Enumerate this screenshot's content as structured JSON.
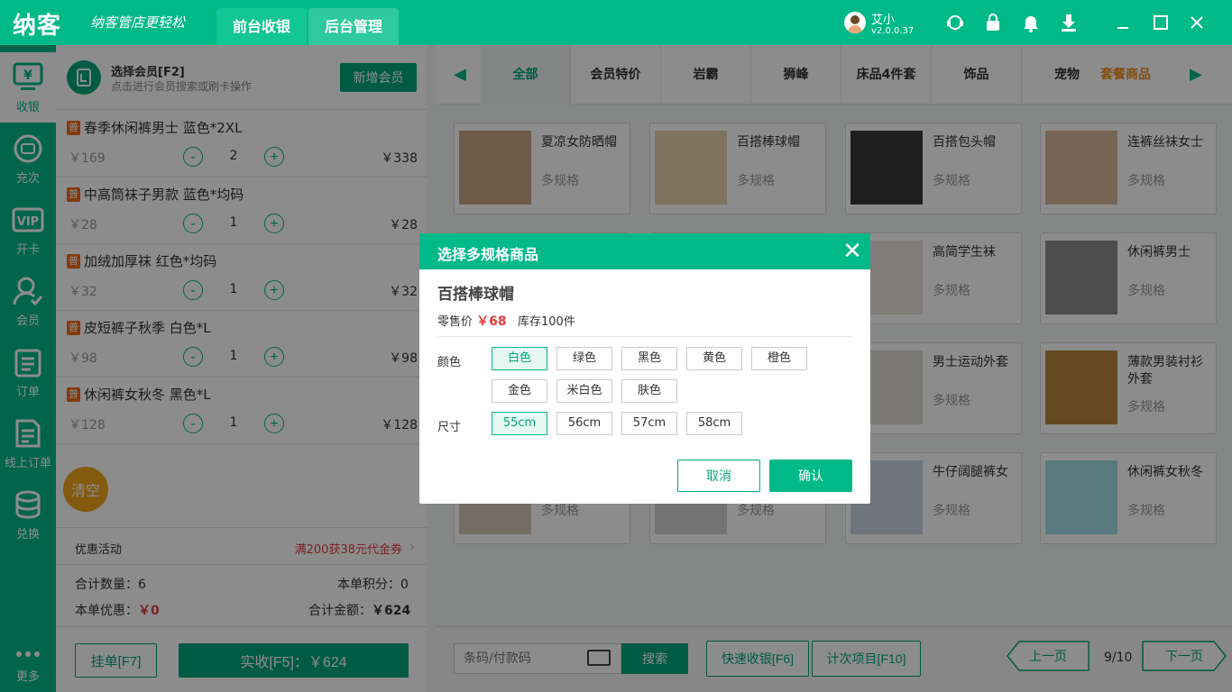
{
  "app": {
    "logo": "纳客",
    "slogan": "纳客管店更轻松",
    "tab_front": "前台收银",
    "tab_back": "后台管理",
    "user_name": "艾小",
    "version": "v2.0.0.37"
  },
  "sidebar": {
    "items": [
      {
        "label": "收银",
        "icon": "cashier-icon"
      },
      {
        "label": "充次",
        "icon": "recharge-icon"
      },
      {
        "label": "开卡",
        "icon": "vip-card-icon"
      },
      {
        "label": "会员",
        "icon": "member-icon"
      },
      {
        "label": "订单",
        "icon": "order-icon"
      },
      {
        "label": "线上订单",
        "icon": "online-order-icon"
      },
      {
        "label": "兑换",
        "icon": "exchange-icon"
      },
      {
        "label": "更多",
        "icon": "more-icon"
      }
    ]
  },
  "cart": {
    "member_title": "选择会员[F2]",
    "member_sub": "点击进行会员搜索或刷卡操作",
    "add_member": "新增会员",
    "items": [
      {
        "badge": "普",
        "name": "春季休闲裤男士 蓝色*2XL",
        "price": "￥169",
        "qty": "2",
        "subtotal": "￥338"
      },
      {
        "badge": "普",
        "name": "中高筒袜子男款 蓝色*均码",
        "price": "￥28",
        "qty": "1",
        "subtotal": "￥28"
      },
      {
        "badge": "普",
        "name": "加绒加厚袜 红色*均码",
        "price": "￥32",
        "qty": "1",
        "subtotal": "￥32"
      },
      {
        "badge": "普",
        "name": "皮短裤子秋季 白色*L",
        "price": "￥98",
        "qty": "1",
        "subtotal": "￥98"
      },
      {
        "badge": "普",
        "name": "休闲裤女秋冬 黑色*L",
        "price": "￥128",
        "qty": "1",
        "subtotal": "￥128"
      }
    ],
    "minus": "-",
    "plus": "+",
    "clear": "清空",
    "promo_label": "优惠活动",
    "promo_value": "满200获38元代金券",
    "total_qty_label": "合计数量：",
    "total_qty": "6",
    "points_label": "本单积分：",
    "points": "0",
    "discount_label": "本单优惠：",
    "discount": "￥0",
    "total_amount_label": "合计金额：",
    "total_amount": "￥624",
    "hold_button": "挂单[F7]",
    "pay_button": "实收[F5]：￥624"
  },
  "categories": [
    "全部",
    "会员特价",
    "岩霸",
    "狮峰",
    "床品4件套",
    "饰品",
    "宠物",
    "套餐商品"
  ],
  "products": [
    {
      "name": "夏凉女防晒帽",
      "spec": "多规格"
    },
    {
      "name": "百搭棒球帽",
      "spec": "多规格"
    },
    {
      "name": "百搭包头帽",
      "spec": "多规格"
    },
    {
      "name": "连裤丝袜女士",
      "spec": "多规格"
    },
    {
      "name": "高简学生袜",
      "spec": "多规格"
    },
    {
      "name": "休闲裤男士",
      "spec": "多规格"
    },
    {
      "name": "男士运动外套",
      "spec": "多规格"
    },
    {
      "name": "薄款男装衬衫外套",
      "spec": "多规格"
    },
    {
      "name": "",
      "spec": "多规格"
    },
    {
      "name": "",
      "spec": "多规格"
    },
    {
      "name": "牛仔阔腿裤女",
      "spec": "多规格"
    },
    {
      "name": "休闲裤女秋冬",
      "spec": "多规格"
    }
  ],
  "bottom": {
    "barcode_placeholder": "条码/付款码",
    "search": "搜索",
    "quick_pay": "快速收银[F6]",
    "count_item": "计次项目[F10]",
    "prev": "上一页",
    "page": "9/10",
    "next": "下一页"
  },
  "modal": {
    "title": "选择多规格商品",
    "product": "百搭棒球帽",
    "price_label": "零售价",
    "price": "￥68",
    "stock": "库存100件",
    "color_label": "颜色",
    "colors": [
      "白色",
      "绿色",
      "黑色",
      "黄色",
      "橙色",
      "金色",
      "米白色",
      "肤色"
    ],
    "selected_color": "白色",
    "size_label": "尺寸",
    "sizes": [
      "55cm",
      "56cm",
      "57cm",
      "58cm"
    ],
    "selected_size": "55cm",
    "cancel": "取消",
    "confirm": "确认"
  },
  "colors": {
    "brand": "#00b988",
    "brand_dark": "#00a77a",
    "red": "#e43d40",
    "orange": "#ef8b1b"
  }
}
